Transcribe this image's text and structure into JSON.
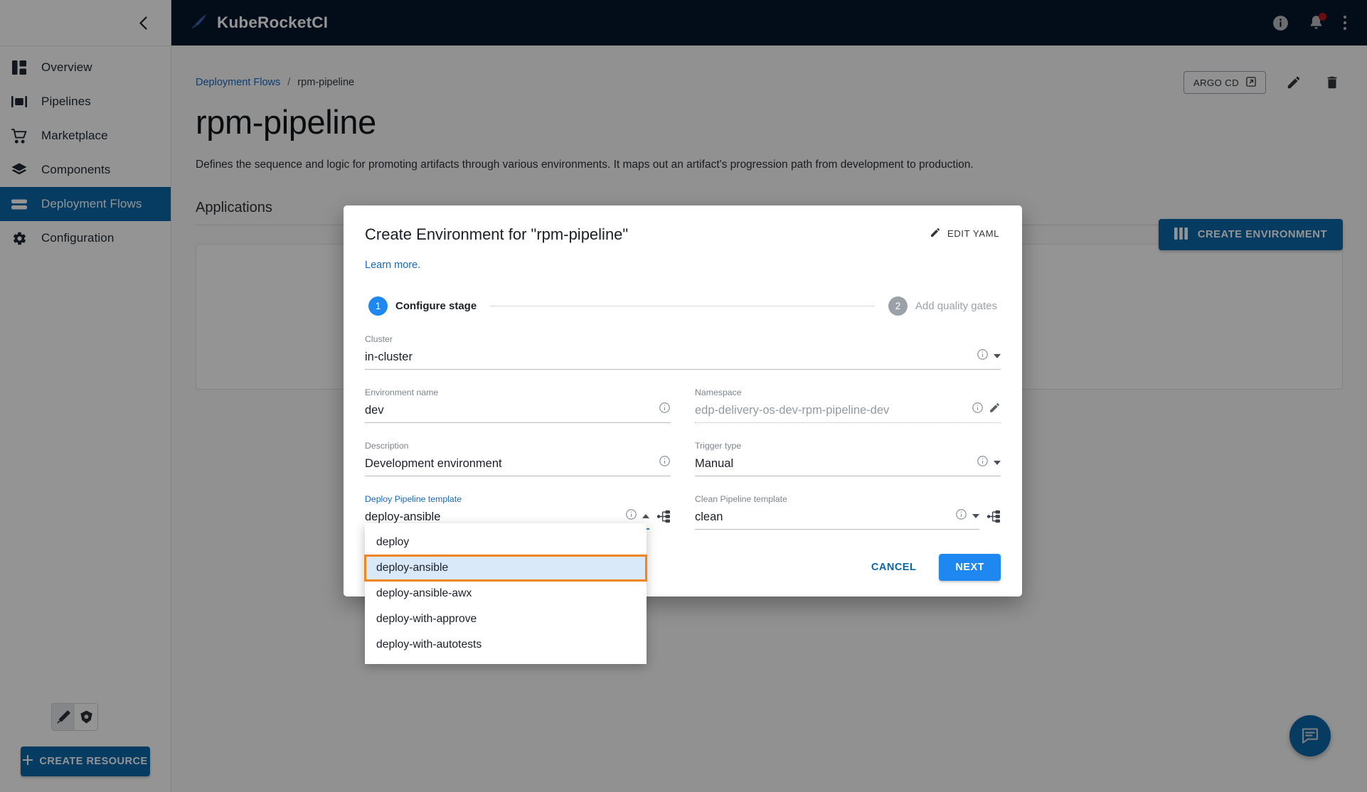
{
  "sidebar": {
    "collapse_icon": "chevron-left-icon",
    "items": [
      {
        "label": "Overview",
        "icon": "dashboard-icon",
        "active": false
      },
      {
        "label": "Pipelines",
        "icon": "pipelines-icon",
        "active": false
      },
      {
        "label": "Marketplace",
        "icon": "cart-icon",
        "active": false
      },
      {
        "label": "Components",
        "icon": "layers-icon",
        "active": false
      },
      {
        "label": "Deployment Flows",
        "icon": "flows-icon",
        "active": true
      },
      {
        "label": "Configuration",
        "icon": "gear-icon",
        "active": false
      }
    ],
    "logo_toggle": [
      {
        "icon": "krci-sword-icon",
        "selected": true
      },
      {
        "icon": "kubernetes-icon",
        "selected": false
      }
    ],
    "create_resource_label": "CREATE RESOURCE",
    "create_resource_icon": "plus-icon"
  },
  "topbar": {
    "brand": "KubeRocketCI",
    "brand_icon": "rocket-feather-icon",
    "actions": [
      {
        "icon": "info-icon",
        "name": "info-button"
      },
      {
        "icon": "bell-icon",
        "name": "notifications-button",
        "has_badge": true
      },
      {
        "icon": "kebab-menu-icon",
        "name": "more-menu-button"
      }
    ]
  },
  "page": {
    "breadcrumb": {
      "parent": "Deployment Flows",
      "separator": "/",
      "current": "rpm-pipeline"
    },
    "title": "rpm-pipeline",
    "description": "Defines the sequence and logic for promoting artifacts through various environments. It maps out an artifact's progression path from development to production.",
    "actions": {
      "argocd_label": "ARGO CD",
      "argocd_icon": "external-link-icon",
      "edit_icon": "pencil-icon",
      "delete_icon": "trash-icon"
    },
    "applications_section_title": "Applications",
    "create_environment_label": "CREATE ENVIRONMENT",
    "create_environment_icon": "columns-icon",
    "chat_fab_icon": "chat-icon"
  },
  "dialog": {
    "title": "Create Environment for \"rpm-pipeline\"",
    "edit_yaml_label": "EDIT YAML",
    "edit_yaml_icon": "pencil-icon",
    "learn_more": "Learn more.",
    "stepper": [
      {
        "num": "1",
        "label": "Configure stage",
        "state": "active"
      },
      {
        "num": "2",
        "label": "Add quality gates",
        "state": "inactive"
      }
    ],
    "fields": {
      "cluster": {
        "label": "Cluster",
        "value": "in-cluster",
        "info_icon": "info-outline-icon",
        "caret": "chevron-down-icon"
      },
      "environment_name": {
        "label": "Environment name",
        "value": "dev",
        "info_icon": "info-outline-icon"
      },
      "namespace": {
        "label": "Namespace",
        "placeholder": "edp-delivery-os-dev-rpm-pipeline-dev",
        "value": "",
        "info_icon": "info-outline-icon",
        "edit_icon": "pencil-icon"
      },
      "description": {
        "label": "Description",
        "value": "Development environment",
        "info_icon": "info-outline-icon"
      },
      "trigger_type": {
        "label": "Trigger type",
        "value": "Manual",
        "info_icon": "info-outline-icon",
        "caret": "chevron-down-icon"
      },
      "deploy_pipeline_template": {
        "label": "Deploy Pipeline template",
        "value": "deploy-ansible",
        "info_icon": "info-outline-icon",
        "caret": "chevron-up-icon",
        "side_icon": "pipeline-tree-icon",
        "open": true
      },
      "clean_pipeline_template": {
        "label": "Clean Pipeline template",
        "value": "clean",
        "info_icon": "info-outline-icon",
        "caret": "chevron-down-icon",
        "side_icon": "pipeline-tree-icon"
      }
    },
    "dropdown_options": [
      {
        "label": "deploy",
        "selected": false
      },
      {
        "label": "deploy-ansible",
        "selected": true
      },
      {
        "label": "deploy-ansible-awx",
        "selected": false
      },
      {
        "label": "deploy-with-approve",
        "selected": false
      },
      {
        "label": "deploy-with-autotests",
        "selected": false
      }
    ],
    "cancel_label": "CANCEL",
    "next_label": "NEXT"
  },
  "colors": {
    "brand_dark": "#06172c",
    "accent_blue": "#0b66a9",
    "primary_blue": "#1e88f0",
    "link_blue": "#1668bf",
    "highlight_orange": "#ef8521",
    "selected_row_bg": "#d9e9fa",
    "badge_red": "#b11919"
  }
}
